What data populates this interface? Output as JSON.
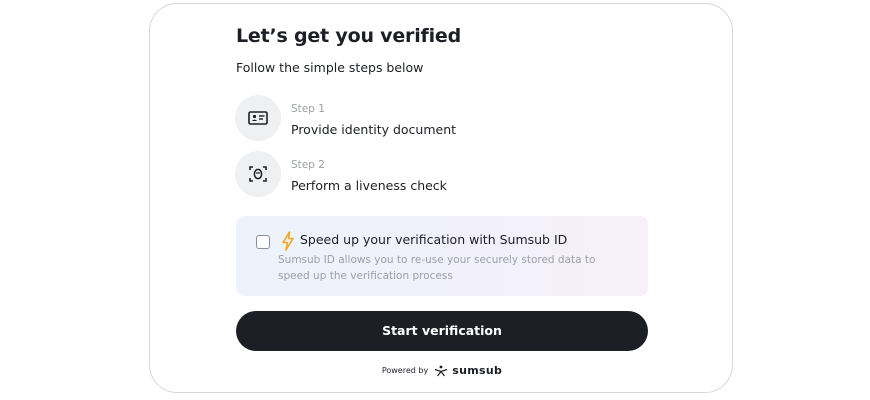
{
  "header": {
    "title": "Let’s get you verified",
    "subtitle": "Follow the simple steps below"
  },
  "steps": [
    {
      "number": "Step 1",
      "label": "Provide identity document",
      "icon": "id-card-icon"
    },
    {
      "number": "Step 2",
      "label": "Perform a liveness check",
      "icon": "face-scan-icon"
    }
  ],
  "promo": {
    "checked": false,
    "icon": "lightning-bolt-icon",
    "title": "Speed up your verification with Sumsub ID",
    "description": "Sumsub ID allows you to re-use your securely stored data to speed up the verification process"
  },
  "actions": {
    "start_label": "Start verification"
  },
  "footer": {
    "powered_by": "Powered by",
    "brand": "sumsub",
    "logo_icon": "sumsub-logo-icon"
  },
  "colors": {
    "button_bg": "#1c1f26",
    "button_text": "#ffffff",
    "bolt": "#f5a623",
    "muted_text": "#9aa0a8",
    "icon_circle": "#eff0f2"
  }
}
